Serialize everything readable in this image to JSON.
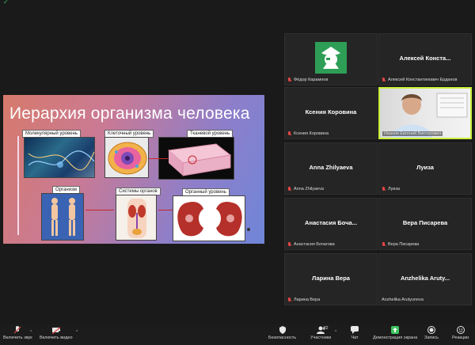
{
  "slide": {
    "title": "Иерархия организма человека",
    "labels": {
      "molecular": "Молекулярный уровень",
      "cellular": "Клеточный уровень",
      "tissue": "Тканевой уровень",
      "organism": "Организм",
      "systems": "Системы органов",
      "organ": "Органный уровень"
    }
  },
  "participants": [
    {
      "tile_label": "",
      "footer": "Фёдор Карамнов",
      "avatar": "pirate-avatar-icon"
    },
    {
      "tile_label": "Алексей  Конста...",
      "footer": "Алексей Константинович Ерданов"
    },
    {
      "tile_label": "Ксения Коровина",
      "footer": "Ксения Коровина"
    },
    {
      "tile_label": "",
      "footer": "Иванов Евгений Викторович",
      "video": true
    },
    {
      "tile_label": "Anna Zhilyaeva",
      "footer": "Anna Zhilyaeva"
    },
    {
      "tile_label": "Луиза",
      "footer": "Луиза"
    },
    {
      "tile_label": "Анастасия  Боча...",
      "footer": "Анастасия Бочагова"
    },
    {
      "tile_label": "Вера Писарева",
      "footer": "Вера Писарева"
    },
    {
      "tile_label": "Ларина Вера",
      "footer": "Ларина Вера"
    },
    {
      "tile_label": "Anzhelika  Aruty...",
      "footer": "Anzhelika Arutyunova"
    }
  ],
  "toolbar": {
    "unmute": "Включить звук",
    "start_video": "Включить видео",
    "security": "Безопасность",
    "participants": "Участники",
    "participants_count": "32",
    "chat": "Чат",
    "share_screen": "Демонстрация экрана",
    "record": "Запись",
    "reactions": "Реакции"
  },
  "colors": {
    "share_green": "#3ec35e",
    "mic_muted": "#e04545",
    "avatar_bg": "#2e9e57"
  }
}
